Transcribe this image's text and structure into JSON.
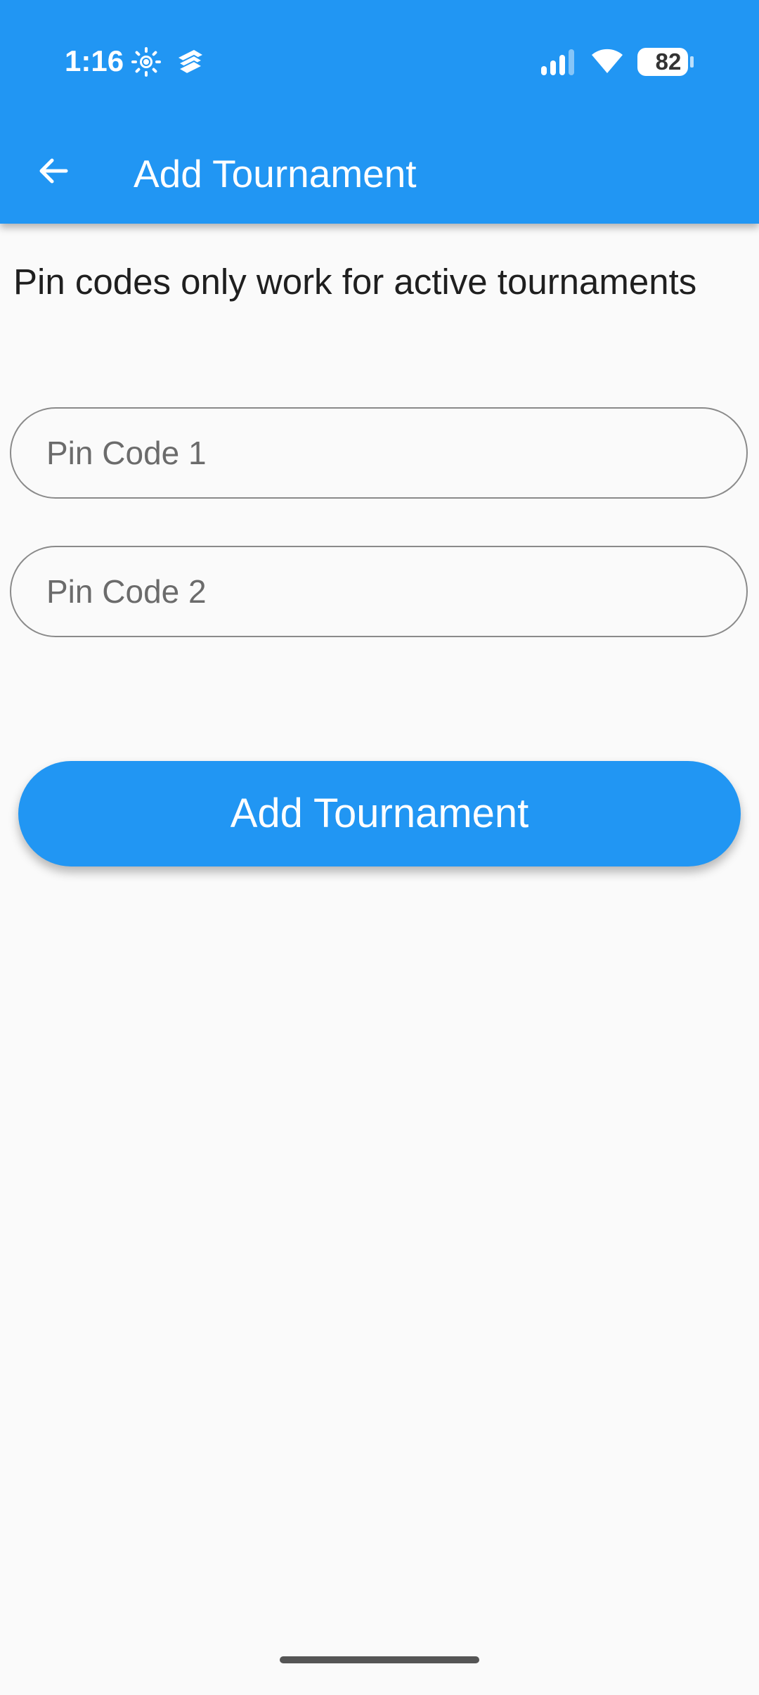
{
  "status_bar": {
    "time": "1:16",
    "battery_level": "82",
    "icons": [
      "brightness-icon",
      "stack-app-icon",
      "signal-icon",
      "wifi-icon",
      "battery-icon"
    ]
  },
  "toolbar": {
    "back_icon": "arrow-left-icon",
    "title": "Add Tournament"
  },
  "main": {
    "info_text": "Pin codes only work for active tournaments",
    "pin_code_1": {
      "placeholder": "Pin Code 1",
      "value": ""
    },
    "pin_code_2": {
      "placeholder": "Pin Code 2",
      "value": ""
    },
    "add_button_label": "Add Tournament"
  },
  "colors": {
    "primary": "#2196F3",
    "background": "#FAFAFA",
    "text": "#1F1F1F",
    "placeholder": "#6B6B6B",
    "field_border": "#8A8A8A"
  }
}
